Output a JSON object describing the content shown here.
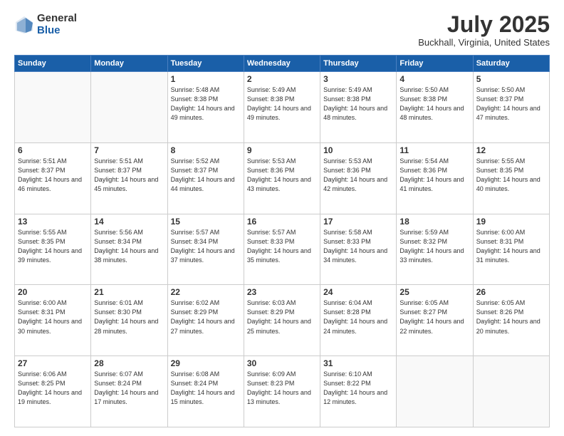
{
  "header": {
    "logo_general": "General",
    "logo_blue": "Blue",
    "title": "July 2025",
    "location": "Buckhall, Virginia, United States"
  },
  "weekdays": [
    "Sunday",
    "Monday",
    "Tuesday",
    "Wednesday",
    "Thursday",
    "Friday",
    "Saturday"
  ],
  "weeks": [
    [
      {
        "day": "",
        "sunrise": "",
        "sunset": "",
        "daylight": ""
      },
      {
        "day": "",
        "sunrise": "",
        "sunset": "",
        "daylight": ""
      },
      {
        "day": "1",
        "sunrise": "Sunrise: 5:48 AM",
        "sunset": "Sunset: 8:38 PM",
        "daylight": "Daylight: 14 hours and 49 minutes."
      },
      {
        "day": "2",
        "sunrise": "Sunrise: 5:49 AM",
        "sunset": "Sunset: 8:38 PM",
        "daylight": "Daylight: 14 hours and 49 minutes."
      },
      {
        "day": "3",
        "sunrise": "Sunrise: 5:49 AM",
        "sunset": "Sunset: 8:38 PM",
        "daylight": "Daylight: 14 hours and 48 minutes."
      },
      {
        "day": "4",
        "sunrise": "Sunrise: 5:50 AM",
        "sunset": "Sunset: 8:38 PM",
        "daylight": "Daylight: 14 hours and 48 minutes."
      },
      {
        "day": "5",
        "sunrise": "Sunrise: 5:50 AM",
        "sunset": "Sunset: 8:37 PM",
        "daylight": "Daylight: 14 hours and 47 minutes."
      }
    ],
    [
      {
        "day": "6",
        "sunrise": "Sunrise: 5:51 AM",
        "sunset": "Sunset: 8:37 PM",
        "daylight": "Daylight: 14 hours and 46 minutes."
      },
      {
        "day": "7",
        "sunrise": "Sunrise: 5:51 AM",
        "sunset": "Sunset: 8:37 PM",
        "daylight": "Daylight: 14 hours and 45 minutes."
      },
      {
        "day": "8",
        "sunrise": "Sunrise: 5:52 AM",
        "sunset": "Sunset: 8:37 PM",
        "daylight": "Daylight: 14 hours and 44 minutes."
      },
      {
        "day": "9",
        "sunrise": "Sunrise: 5:53 AM",
        "sunset": "Sunset: 8:36 PM",
        "daylight": "Daylight: 14 hours and 43 minutes."
      },
      {
        "day": "10",
        "sunrise": "Sunrise: 5:53 AM",
        "sunset": "Sunset: 8:36 PM",
        "daylight": "Daylight: 14 hours and 42 minutes."
      },
      {
        "day": "11",
        "sunrise": "Sunrise: 5:54 AM",
        "sunset": "Sunset: 8:36 PM",
        "daylight": "Daylight: 14 hours and 41 minutes."
      },
      {
        "day": "12",
        "sunrise": "Sunrise: 5:55 AM",
        "sunset": "Sunset: 8:35 PM",
        "daylight": "Daylight: 14 hours and 40 minutes."
      }
    ],
    [
      {
        "day": "13",
        "sunrise": "Sunrise: 5:55 AM",
        "sunset": "Sunset: 8:35 PM",
        "daylight": "Daylight: 14 hours and 39 minutes."
      },
      {
        "day": "14",
        "sunrise": "Sunrise: 5:56 AM",
        "sunset": "Sunset: 8:34 PM",
        "daylight": "Daylight: 14 hours and 38 minutes."
      },
      {
        "day": "15",
        "sunrise": "Sunrise: 5:57 AM",
        "sunset": "Sunset: 8:34 PM",
        "daylight": "Daylight: 14 hours and 37 minutes."
      },
      {
        "day": "16",
        "sunrise": "Sunrise: 5:57 AM",
        "sunset": "Sunset: 8:33 PM",
        "daylight": "Daylight: 14 hours and 35 minutes."
      },
      {
        "day": "17",
        "sunrise": "Sunrise: 5:58 AM",
        "sunset": "Sunset: 8:33 PM",
        "daylight": "Daylight: 14 hours and 34 minutes."
      },
      {
        "day": "18",
        "sunrise": "Sunrise: 5:59 AM",
        "sunset": "Sunset: 8:32 PM",
        "daylight": "Daylight: 14 hours and 33 minutes."
      },
      {
        "day": "19",
        "sunrise": "Sunrise: 6:00 AM",
        "sunset": "Sunset: 8:31 PM",
        "daylight": "Daylight: 14 hours and 31 minutes."
      }
    ],
    [
      {
        "day": "20",
        "sunrise": "Sunrise: 6:00 AM",
        "sunset": "Sunset: 8:31 PM",
        "daylight": "Daylight: 14 hours and 30 minutes."
      },
      {
        "day": "21",
        "sunrise": "Sunrise: 6:01 AM",
        "sunset": "Sunset: 8:30 PM",
        "daylight": "Daylight: 14 hours and 28 minutes."
      },
      {
        "day": "22",
        "sunrise": "Sunrise: 6:02 AM",
        "sunset": "Sunset: 8:29 PM",
        "daylight": "Daylight: 14 hours and 27 minutes."
      },
      {
        "day": "23",
        "sunrise": "Sunrise: 6:03 AM",
        "sunset": "Sunset: 8:29 PM",
        "daylight": "Daylight: 14 hours and 25 minutes."
      },
      {
        "day": "24",
        "sunrise": "Sunrise: 6:04 AM",
        "sunset": "Sunset: 8:28 PM",
        "daylight": "Daylight: 14 hours and 24 minutes."
      },
      {
        "day": "25",
        "sunrise": "Sunrise: 6:05 AM",
        "sunset": "Sunset: 8:27 PM",
        "daylight": "Daylight: 14 hours and 22 minutes."
      },
      {
        "day": "26",
        "sunrise": "Sunrise: 6:05 AM",
        "sunset": "Sunset: 8:26 PM",
        "daylight": "Daylight: 14 hours and 20 minutes."
      }
    ],
    [
      {
        "day": "27",
        "sunrise": "Sunrise: 6:06 AM",
        "sunset": "Sunset: 8:25 PM",
        "daylight": "Daylight: 14 hours and 19 minutes."
      },
      {
        "day": "28",
        "sunrise": "Sunrise: 6:07 AM",
        "sunset": "Sunset: 8:24 PM",
        "daylight": "Daylight: 14 hours and 17 minutes."
      },
      {
        "day": "29",
        "sunrise": "Sunrise: 6:08 AM",
        "sunset": "Sunset: 8:24 PM",
        "daylight": "Daylight: 14 hours and 15 minutes."
      },
      {
        "day": "30",
        "sunrise": "Sunrise: 6:09 AM",
        "sunset": "Sunset: 8:23 PM",
        "daylight": "Daylight: 14 hours and 13 minutes."
      },
      {
        "day": "31",
        "sunrise": "Sunrise: 6:10 AM",
        "sunset": "Sunset: 8:22 PM",
        "daylight": "Daylight: 14 hours and 12 minutes."
      },
      {
        "day": "",
        "sunrise": "",
        "sunset": "",
        "daylight": ""
      },
      {
        "day": "",
        "sunrise": "",
        "sunset": "",
        "daylight": ""
      }
    ]
  ]
}
